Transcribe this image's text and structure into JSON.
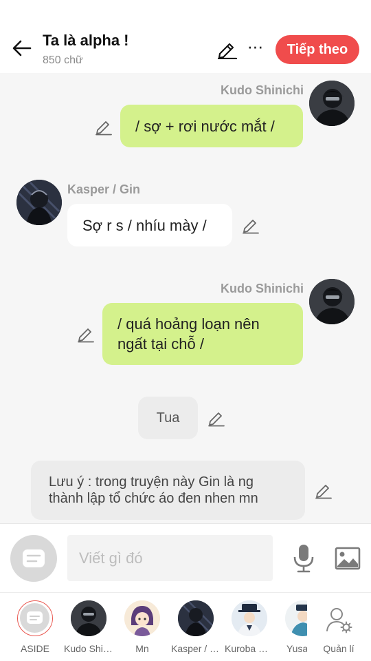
{
  "header": {
    "title": "Ta là alpha !",
    "word_count": "850 chữ",
    "next_label": "Tiếp theo",
    "more_glyph": "···"
  },
  "messages": [
    {
      "kind": "right",
      "sender": "Kudo Shinichi",
      "text": "/ sợ + rơi nước mắt /"
    },
    {
      "kind": "left",
      "sender": "Kasper / Gin",
      "text": "Sợ r s / nhíu mày /"
    },
    {
      "kind": "right",
      "sender": "Kudo Shinichi",
      "text_line1": "/ quá hoảng loạn nên",
      "text_line2": "ngất tại chỗ /"
    },
    {
      "kind": "center",
      "text": "Tua"
    },
    {
      "kind": "note",
      "text_line1": "Lưu ý : trong truyện này Gin là ng",
      "text_line2": "thành lập tổ chức áo đen nhen mn"
    }
  ],
  "composer": {
    "placeholder": "Viết gì đó"
  },
  "characters": [
    {
      "label": "ASIDE"
    },
    {
      "label": "Kudo Shinichi"
    },
    {
      "label": "Mn"
    },
    {
      "label": "Kasper / Gin"
    },
    {
      "label": "Kuroba Kaito"
    },
    {
      "label": "Yusa"
    },
    {
      "label": "Quản lí"
    }
  ],
  "colors": {
    "accent": "#f04c4c",
    "bubble_self": "#d4f18c",
    "bubble_other": "#ffffff",
    "bubble_narration": "#ececec",
    "background": "#f6f6f6"
  },
  "icons": [
    "back-arrow-icon",
    "pencil-icon",
    "more-icon",
    "chat-bubble-icon",
    "microphone-icon",
    "image-icon",
    "user-gear-icon"
  ]
}
